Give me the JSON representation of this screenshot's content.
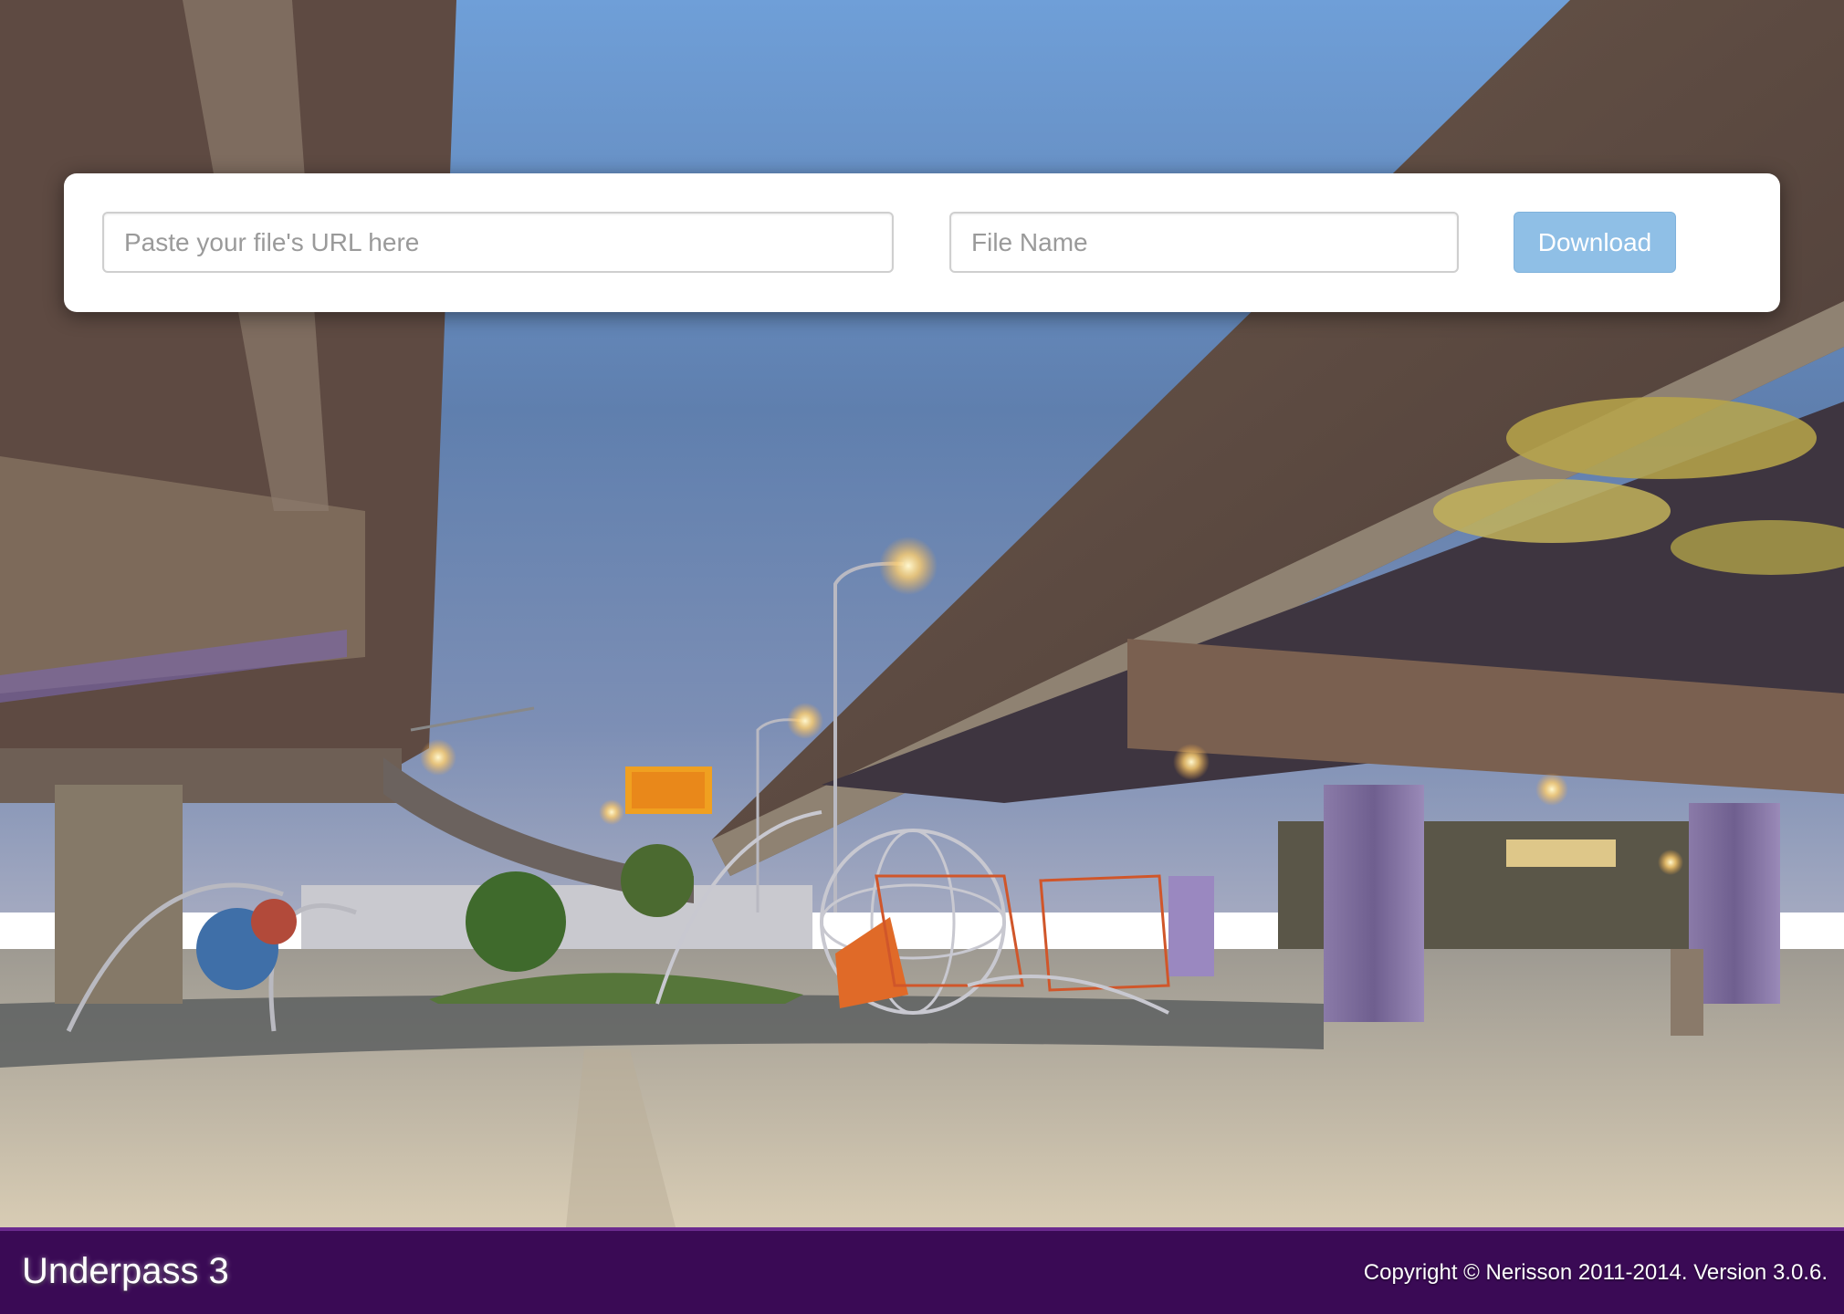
{
  "panel": {
    "url_placeholder": "Paste your file's URL here",
    "url_value": "",
    "name_placeholder": "File Name",
    "name_value": "",
    "download_label": "Download"
  },
  "footer": {
    "app_title": "Underpass 3",
    "copyright": "Copyright © Nerisson 2011-2014. Version 3.0.6."
  },
  "colors": {
    "footer_background": "#3a0a55",
    "download_button": "#8fbfe6",
    "panel_background": "#ffffff"
  },
  "background": {
    "icon": "underpass-playground-photo"
  }
}
